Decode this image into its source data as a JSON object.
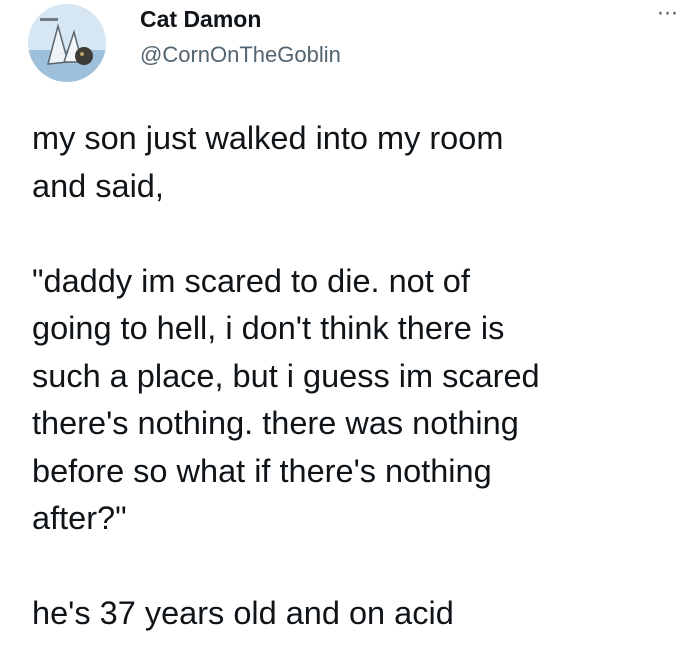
{
  "tweet": {
    "author": {
      "display_name": "Cat Damon",
      "handle": "@CornOnTheGoblin",
      "avatar_icon": "avatar-image"
    },
    "more_icon": "more-options-icon",
    "more_label": "···",
    "paragraphs": [
      "my son just walked into my room\nand said,",
      "\"daddy im scared to die. not of\ngoing to hell, i don't think there is\nsuch a place, but i guess im scared\nthere's nothing. there was nothing\nbefore so what if there's nothing\nafter?\"",
      "he's 37 years old and on acid"
    ]
  },
  "colors": {
    "text": "#0f1419",
    "secondary_text": "#536471",
    "background": "#ffffff"
  }
}
